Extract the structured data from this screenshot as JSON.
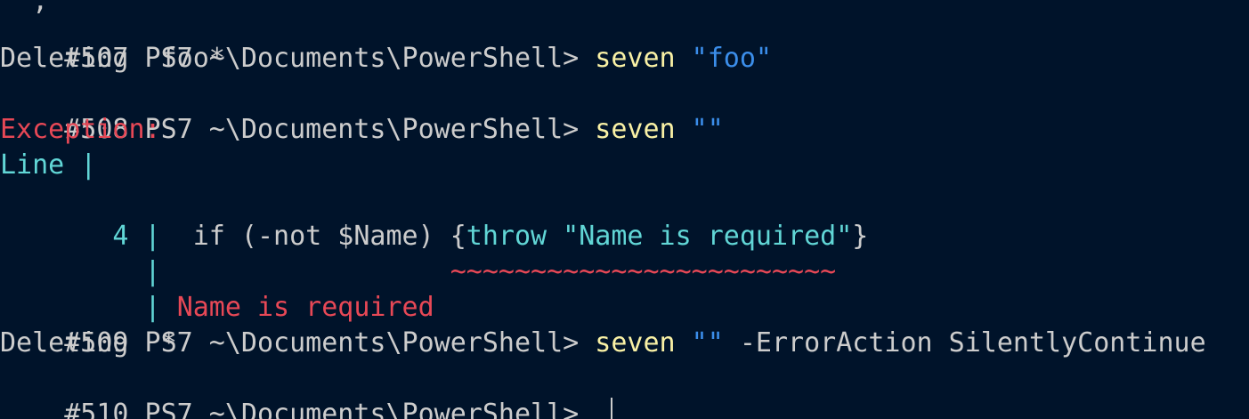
{
  "colors": {
    "background": "#00132a",
    "text": "#cccccc",
    "command": "#f9f1a5",
    "string": "#3b8eea",
    "error": "#e74856",
    "cyan": "#61d6d6"
  },
  "terminal": {
    "clipped_top_text": "  ,",
    "lines": [
      {
        "prompt": "#507 PS7 ~\\Documents\\PowerShell> ",
        "cmd": "seven",
        "arg": " \"foo\""
      },
      {
        "text": "Deleting  foo*"
      },
      {
        "prompt": "#508 PS7 ~\\Documents\\PowerShell> ",
        "cmd": "seven",
        "arg": " \"\""
      },
      {
        "text": "Exception:"
      },
      {
        "text": "Line |"
      },
      {
        "gutter": "   4 |  ",
        "code_prefix": "if (-not $Name) {",
        "code_throw": "throw \"Name is required\"",
        "code_suffix": "}"
      },
      {
        "gutter": "     |",
        "underline": "                  ~~~~~~~~~~~~~~~~~~~~~~~~"
      },
      {
        "gutter": "     | ",
        "message": "Name is required"
      },
      {
        "prompt": "#509 PS7 ~\\Documents\\PowerShell> ",
        "cmd": "seven",
        "arg": " \"\"",
        "params": " -ErrorAction SilentlyContinue"
      },
      {
        "text": "Deleting  *"
      },
      {
        "prompt": "#510 PS7 ~\\Documents\\PowerShell> "
      }
    ]
  }
}
